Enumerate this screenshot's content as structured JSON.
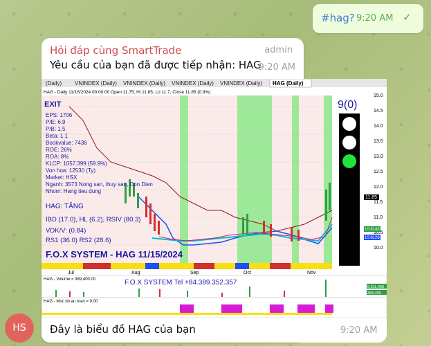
{
  "outgoing": {
    "text": "#hag?",
    "time": "9:20 AM",
    "check": "✓"
  },
  "card": {
    "sender": "Hỏi đáp cùng SmartTrade",
    "role": "admin",
    "message": "Yêu cầu của bạn đã được tiếp nhận: HAG",
    "time": "9:20 AM"
  },
  "chart": {
    "tabs": [
      "(Daily)",
      "VNINDEX (Daily)",
      "VNINDEX (Daily)",
      "VNINDEX (Daily)",
      "VNINDEX (Daily)",
      "HAG (Daily)"
    ],
    "header": "HAG - Daily 11/15/2024 00:00:00 Open 11.75, Hi 11.85, Lo 11.7, Close 11.85 (0.9%)",
    "signal": "EXIT",
    "score": "9(0)",
    "fundamentals": [
      "EPS: 1706",
      "P/E: 6.9",
      "P/B: 1.5",
      "Beta: 1.1",
      "Bookvalue: 7436",
      "ROE: 26%",
      "ROA: 8%",
      "KLCP: 1057.399 (59.9%)",
      "Von hoa: 12530 (Ty)",
      "Market: HSX",
      "Nganh: 3573 Nong san, thuy san, Don Dien",
      "Nhom: Hang tieu dung"
    ],
    "trend": "HAG: TĂNG",
    "ind1": "IBD (17.0), HL (6.2), RSIV (80.3)",
    "ind2": "VDK/V:  (0.84)",
    "ind3": "RS1 (36.0) RS2 (28.6)",
    "system": "F.O.X SYSTEM - HAG 11/15/2024",
    "volume_label": "HAG - Volume = 389,400.00",
    "tel": "F.O.X SYSTEM Tel +84.389.352.357",
    "safety_label": "HAG - Muc do an toan = 9.00",
    "months": [
      "Jul",
      "Aug",
      "Sep",
      "Oct",
      "Nov"
    ],
    "yticks": [
      "15.0",
      "14.5",
      "14.0",
      "13.5",
      "13.0",
      "12.5",
      "12.0",
      "11.5",
      "11.0",
      "10.5",
      "10.0"
    ],
    "price_label": "11.85",
    "side_labels": [
      "10.8143",
      "10.6126"
    ],
    "vol_labels": [
      "5,911,400",
      "389,400"
    ]
  },
  "footer": {
    "message": "Đây là biểu đồ HAG của bạn",
    "time": "9:20 AM",
    "avatar": "HS"
  }
}
